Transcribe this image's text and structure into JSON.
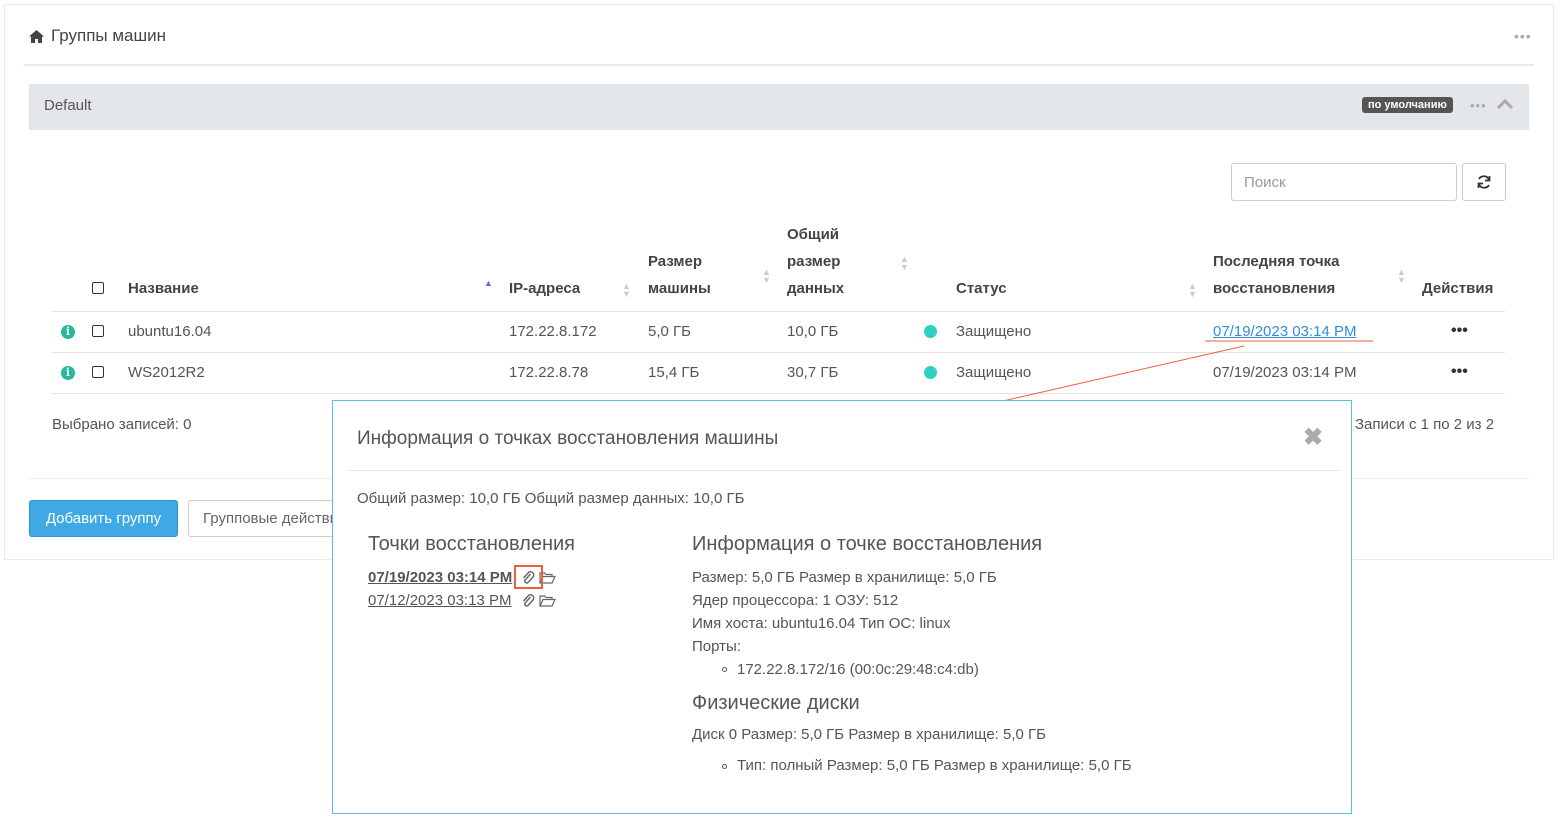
{
  "header": {
    "title": "Группы машин",
    "more": "•••"
  },
  "group": {
    "name": "Default",
    "badge": "по умолчанию",
    "more": "•••"
  },
  "search": {
    "placeholder": "Поиск"
  },
  "table": {
    "columns": {
      "name": "Название",
      "ip": "IP-адреса",
      "machine_size_1": "Размер",
      "machine_size_2": "машины",
      "data_size_1": "Общий",
      "data_size_2": "размер",
      "data_size_3": "данных",
      "status": "Статус",
      "last_point_1": "Последняя точка",
      "last_point_2": "восстановления",
      "actions": "Действия"
    },
    "rows": [
      {
        "name": "ubuntu16.04",
        "ip": "172.22.8.172",
        "machine_size": "5,0 ГБ",
        "data_size": "10,0 ГБ",
        "status": "Защищено",
        "last_point": "07/19/2023 03:14 PM",
        "actions": "•••"
      },
      {
        "name": "WS2012R2",
        "ip": "172.22.8.78",
        "machine_size": "15,4 ГБ",
        "data_size": "30,7 ГБ",
        "status": "Защищено",
        "last_point": "07/19/2023 03:14 PM",
        "actions": "•••"
      }
    ],
    "selected": "Выбрано записей: 0",
    "records": "Записи с 1 по 2 из 2"
  },
  "buttons": {
    "add_group": "Добавить группу",
    "group_actions": "Групповые действия"
  },
  "colors": {
    "accent": "#3fa9e6",
    "status_ok": "#2ed0c2",
    "info": "#26b99a",
    "annotation": "#e8603c"
  },
  "modal": {
    "title": "Информация о точках восстановления машины",
    "close": "✖",
    "summary": "Общий размер: 10,0 ГБ Общий размер данных: 10,0 ГБ",
    "points_heading": "Точки восстановления",
    "points": [
      "07/19/2023 03:14 PM",
      "07/12/2023 03:13 PM"
    ],
    "info_heading": "Информация о точке восстановления",
    "info_lines": [
      "Размер: 5,0 ГБ  Размер в хранилище: 5,0 ГБ",
      "Ядер процессора: 1  ОЗУ: 512",
      "Имя хоста: ubuntu16.04  Тип ОС: linux",
      "Порты:"
    ],
    "port": "172.22.8.172/16 (00:0c:29:48:c4:db)",
    "disks_heading": "Физические диски",
    "disk": "Диск 0  Размер: 5,0 ГБ  Размер в хранилище: 5,0 ГБ",
    "disk_detail": "Тип: полный  Размер: 5,0 ГБ  Размер в хранилище: 5,0 ГБ"
  }
}
